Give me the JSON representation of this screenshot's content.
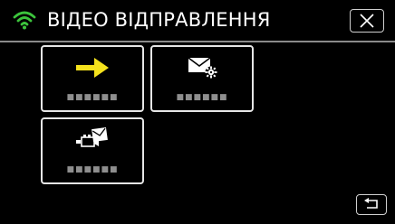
{
  "header": {
    "title": "ВІДЕО ВІДПРАВЛЕННЯ",
    "wifi_icon": "wifi-icon",
    "wifi_color": "#3cc43c",
    "close_icon": "close-icon"
  },
  "tiles": [
    {
      "icon": "arrow-right-icon",
      "icon_color": "#f5e21c",
      "label": "■■■■■■"
    },
    {
      "icon": "mail-settings-icon",
      "label": "■■■■■■"
    },
    {
      "icon": "camera-mail-icon",
      "label": "■■■■■■"
    }
  ],
  "footer": {
    "back_icon": "back-arrow-icon"
  }
}
